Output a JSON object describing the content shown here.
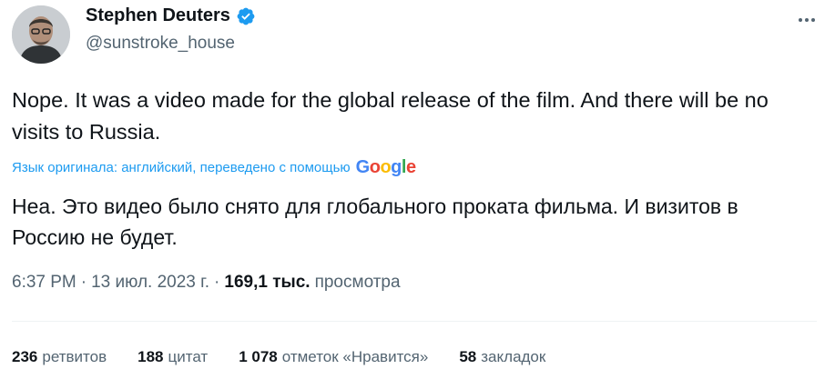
{
  "author": {
    "display_name": "Stephen Deuters",
    "handle": "@sunstroke_house"
  },
  "tweet": {
    "text": "Nope. It was a video made for the global release of the film. And there will be no visits to Russia.",
    "translation_note": "Язык оригинала: английский, переведено с помощью",
    "translation_provider": "Google",
    "translated_text": "Неа. Это видео было снято для глобального проката фильма. И визитов в Россию не будет."
  },
  "meta": {
    "time": "6:37 PM",
    "separator1": "·",
    "date": "13 июл. 2023 г.",
    "separator2": "·",
    "views_count": "169,1 тыс.",
    "views_label": "просмотра"
  },
  "stats": [
    {
      "count": "236",
      "label": "ретвитов"
    },
    {
      "count": "188",
      "label": "цитат"
    },
    {
      "count": "1 078",
      "label": "отметок «Нравится»"
    },
    {
      "count": "58",
      "label": "закладок"
    }
  ],
  "colors": {
    "accent": "#1d9bf0",
    "text_primary": "#0f1419",
    "text_secondary": "#536471",
    "divider": "#eff3f4"
  }
}
